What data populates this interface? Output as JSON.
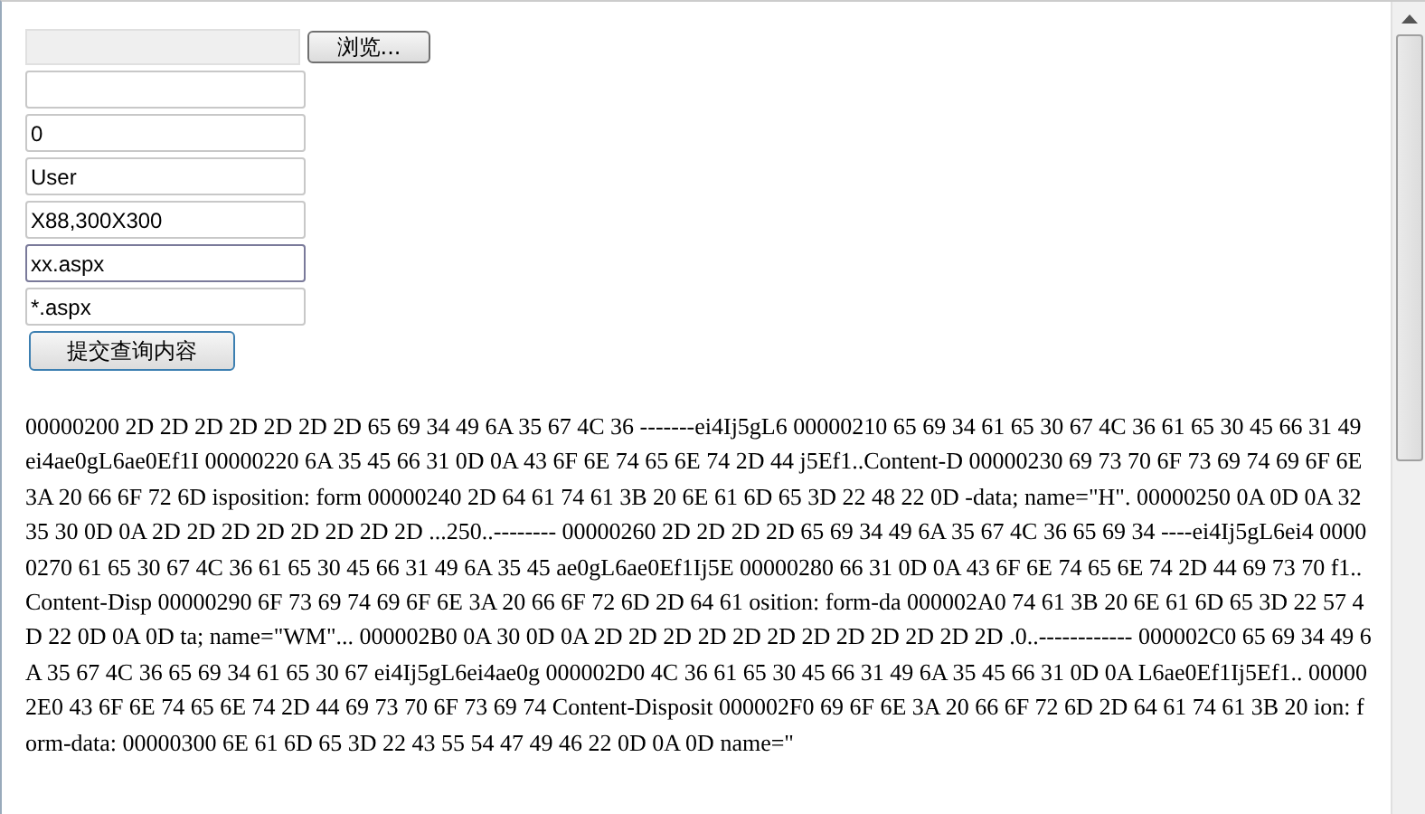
{
  "file_upload": {
    "browse_button": "浏览..."
  },
  "fields": [
    {
      "focused": false
    },
    {
      "value": "0",
      "focused": false
    },
    {
      "value": "User",
      "focused": false
    },
    {
      "value": "X88,300X300",
      "focused": false
    },
    {
      "value": "xx.aspx",
      "focused": true
    },
    {
      "value": "*.aspx",
      "focused": false
    }
  ],
  "submit_button": "提交查询内容",
  "hex_dump": "00000200 2D 2D 2D 2D 2D 2D 2D 65 69 34 49 6A 35 67 4C 36 -------ei4Ij5gL6 00000210 65 69 34 61 65 30 67 4C 36 61 65 30 45 66 31 49 ei4ae0gL6ae0Ef1I 00000220 6A 35 45 66 31 0D 0A 43 6F 6E 74 65 6E 74 2D 44 j5Ef1..Content-D 00000230 69 73 70 6F 73 69 74 69 6F 6E 3A 20 66 6F 72 6D isposition: form 00000240 2D 64 61 74 61 3B 20 6E 61 6D 65 3D 22 48 22 0D -data; name=\"H\". 00000250 0A 0D 0A 32 35 30 0D 0A 2D 2D 2D 2D 2D 2D 2D 2D ...250..-------- 00000260 2D 2D 2D 2D 65 69 34 49 6A 35 67 4C 36 65 69 34 ----ei4Ij5gL6ei4 00000270 61 65 30 67 4C 36 61 65 30 45 66 31 49 6A 35 45 ae0gL6ae0Ef1Ij5E 00000280 66 31 0D 0A 43 6F 6E 74 65 6E 74 2D 44 69 73 70 f1..Content-Disp 00000290 6F 73 69 74 69 6F 6E 3A 20 66 6F 72 6D 2D 64 61 osition: form-da 000002A0 74 61 3B 20 6E 61 6D 65 3D 22 57 4D 22 0D 0A 0D ta; name=\"WM\"... 000002B0 0A 30 0D 0A 2D 2D 2D 2D 2D 2D 2D 2D 2D 2D 2D 2D .0..------------ 000002C0 65 69 34 49 6A 35 67 4C 36 65 69 34 61 65 30 67 ei4Ij5gL6ei4ae0g 000002D0 4C 36 61 65 30 45 66 31 49 6A 35 45 66 31 0D 0A L6ae0Ef1Ij5Ef1.. 000002E0 43 6F 6E 74 65 6E 74 2D 44 69 73 70 6F 73 69 74 Content-Disposit 000002F0 69 6F 6E 3A 20 66 6F 72 6D 2D 64 61 74 61 3B 20 ion: form-data: 00000300 6E 61 6D 65 3D 22 43 55 54 47 49 46 22 0D 0A 0D name=\""
}
